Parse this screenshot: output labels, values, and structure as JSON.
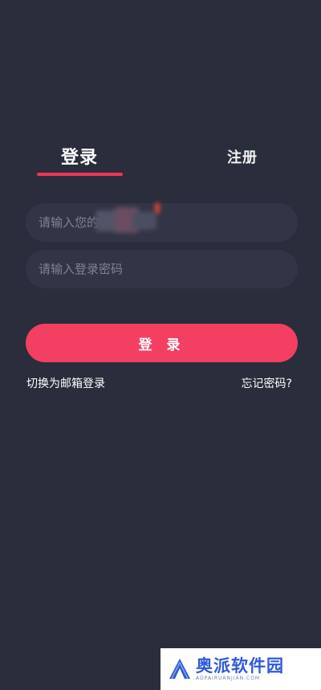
{
  "tabs": {
    "login": "登录",
    "register": "注册"
  },
  "form": {
    "phone_placeholder": "请输入您的手机号码",
    "password_placeholder": "请输入登录密码",
    "submit_label": "登 录"
  },
  "links": {
    "switch_email": "切换为邮箱登录",
    "forgot_password": "忘记密码?"
  },
  "watermark": {
    "name": "奥派软件园",
    "subtitle": "AOPAIRUANJIAN.COM"
  },
  "colors": {
    "background": "#2a2d3b",
    "accent": "#f23f62",
    "field_background": "#323545",
    "watermark_blue": "#2f5ad6"
  },
  "icons": {
    "watermark_logo": "aopai-logo-icon"
  }
}
